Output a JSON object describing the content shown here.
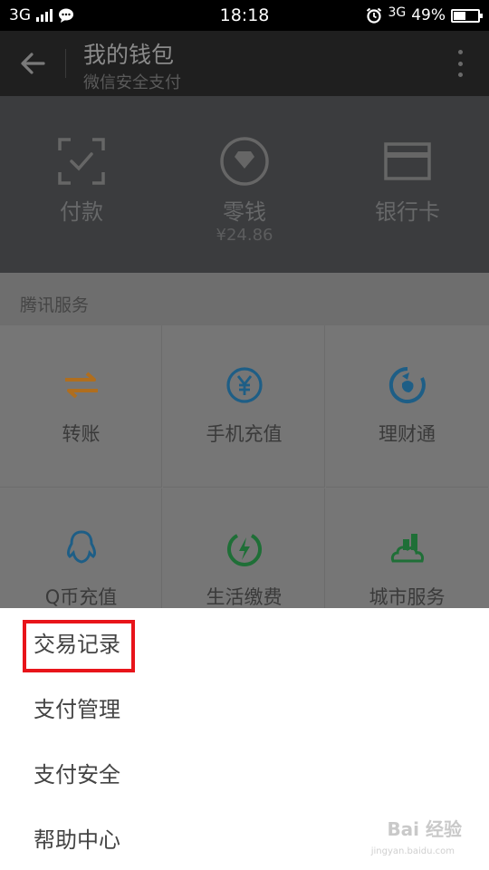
{
  "status_bar": {
    "network_left": "3G",
    "time": "18:18",
    "network_right": "3G",
    "battery": "49%",
    "battery_level": 0.49
  },
  "header": {
    "title": "我的钱包",
    "subtitle": "微信安全支付",
    "back_icon": "arrow-left-icon",
    "more_icon": "more-vertical-icon"
  },
  "wallet": {
    "items": [
      {
        "label": "付款",
        "icon": "scan-pay-icon"
      },
      {
        "label": "零钱",
        "sub": "¥24.86",
        "icon": "diamond-coin-icon"
      },
      {
        "label": "银行卡",
        "icon": "bank-card-icon"
      }
    ]
  },
  "services": {
    "section_title": "腾讯服务",
    "items": [
      {
        "label": "转账",
        "icon": "transfer-icon"
      },
      {
        "label": "手机充值",
        "icon": "yen-circle-icon"
      },
      {
        "label": "理财通",
        "icon": "licaitong-icon"
      },
      {
        "label": "Q币充值",
        "icon": "qq-penguin-icon"
      },
      {
        "label": "生活缴费",
        "icon": "lightning-icon"
      },
      {
        "label": "城市服务",
        "icon": "city-service-icon"
      }
    ]
  },
  "menu": {
    "items": [
      {
        "label": "交易记录"
      },
      {
        "label": "支付管理"
      },
      {
        "label": "支付安全"
      },
      {
        "label": "帮助中心"
      }
    ],
    "highlight_color": "#e8141a"
  },
  "watermark": {
    "text": "Bai 经验",
    "sub": "jingyan.baidu.com"
  },
  "colors": {
    "orange": "#c98a3a",
    "blue": "#2f86b8",
    "green": "#2e9c4e"
  }
}
